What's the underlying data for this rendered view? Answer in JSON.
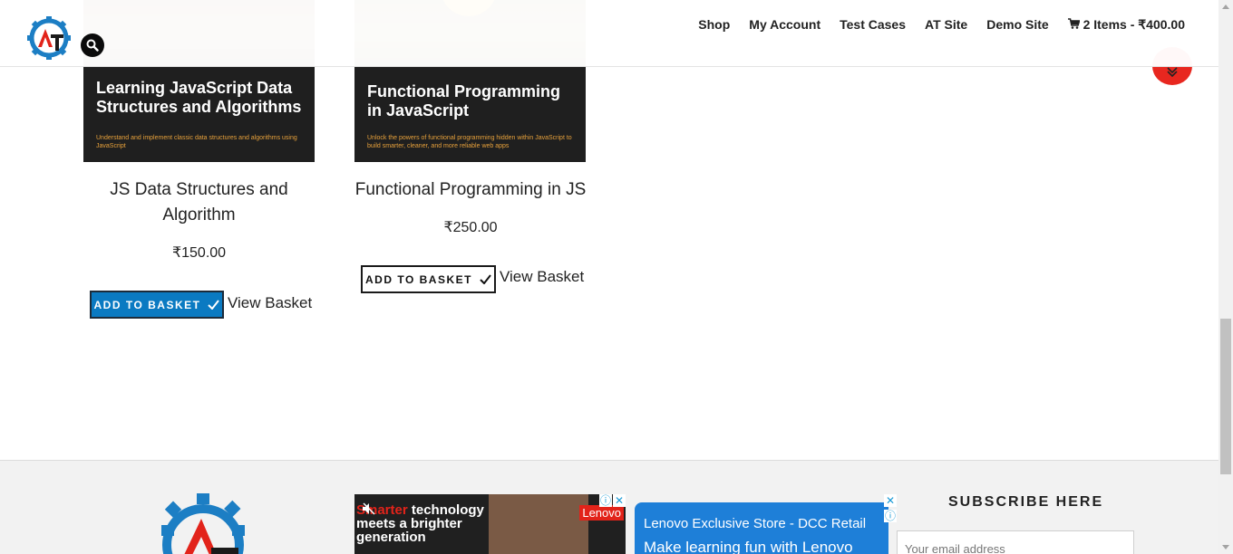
{
  "header": {
    "logo_alt": "AT",
    "nav": [
      "Shop",
      "My Account",
      "Test Cases",
      "AT Site",
      "Demo Site"
    ],
    "cart_label": "2 Items - ₹400.00"
  },
  "products": [
    {
      "cover_title": "Learning JavaScript Data Structures and Algorithms",
      "cover_subtitle": "Understand and implement classic data structures and algorithms using JavaScript",
      "name": "JS Data Structures and Algorithm",
      "price": "₹150.00",
      "button_label": "ADD TO BASKET",
      "view_label": "View Basket"
    },
    {
      "cover_title": "Functional Programming in JavaScript",
      "cover_subtitle": "Unlock the powers of functional programming hidden within JavaScript to build smarter, cleaner, and more reliable web apps",
      "name": "Functional Programming in JS",
      "price": "₹250.00",
      "button_label": "ADD TO BASKET",
      "view_label": "View Basket"
    }
  ],
  "footer": {
    "ad1_line1a": "Smarter",
    "ad1_line1b": " technology",
    "ad1_line2": "meets a brighter",
    "ad1_line3": "generation",
    "ad1_brand": "Lenovo",
    "ad2_line1": "Lenovo Exclusive Store - DCC Retail",
    "ad2_line2": "Make learning fun with Lenovo",
    "subscribe_title": "SUBSCRIBE HERE",
    "email_placeholder": "Your email address"
  },
  "colors": {
    "accent_blue": "#0a7ac2",
    "fab_red": "#e8271f",
    "logo_blue": "#1c7ec4",
    "logo_red": "#e2231a"
  }
}
